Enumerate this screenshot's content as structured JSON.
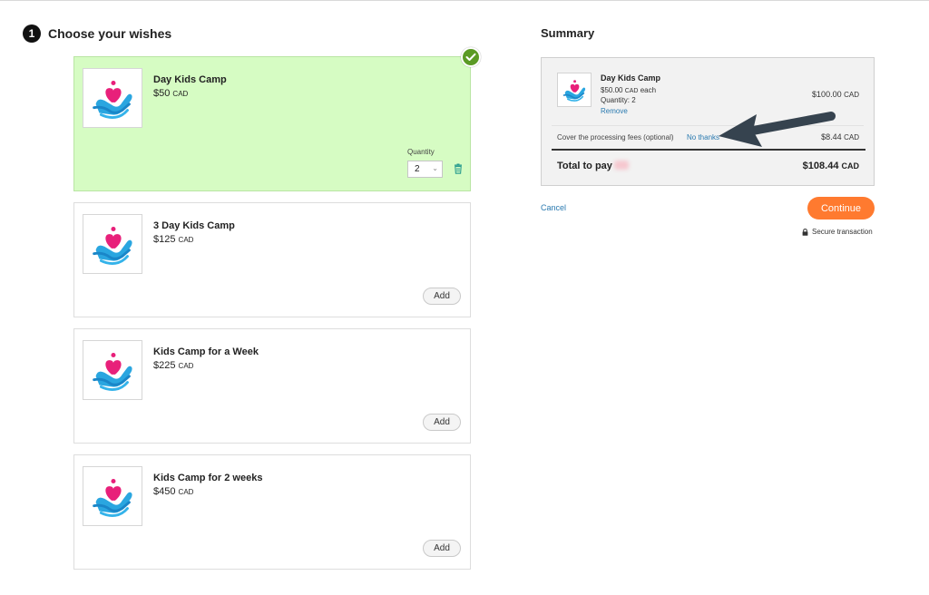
{
  "step": {
    "number": "1",
    "title": "Choose your wishes"
  },
  "items": [
    {
      "name": "Day Kids Camp",
      "price": "$50",
      "currency": "CAD",
      "selected": true,
      "quantity_label": "Quantity",
      "quantity": "2"
    },
    {
      "name": "3 Day Kids Camp",
      "price": "$125",
      "currency": "CAD",
      "add_label": "Add"
    },
    {
      "name": "Kids Camp for a Week",
      "price": "$225",
      "currency": "CAD",
      "add_label": "Add"
    },
    {
      "name": "Kids Camp for 2 weeks",
      "price": "$450",
      "currency": "CAD",
      "add_label": "Add"
    }
  ],
  "icons": {
    "item_image": "hand-holding-heart-icon",
    "selected_badge": "check-icon",
    "delete": "trash-icon",
    "secure": "lock-icon"
  },
  "summary": {
    "title": "Summary",
    "line": {
      "name": "Day Kids Camp",
      "each_price": "$50.00",
      "each_currency": "CAD",
      "each_suffix": "each",
      "quantity": "Quantity: 2",
      "remove_label": "Remove",
      "total": "$100.00",
      "total_currency": "CAD"
    },
    "fee": {
      "label": "Cover the processing fees (optional)",
      "decline_label": "No thanks",
      "amount": "$8.44",
      "currency": "CAD"
    },
    "total_label": "Total to pay",
    "total_amount": "$108.44",
    "total_currency": "CAD"
  },
  "actions": {
    "cancel_label": "Cancel",
    "continue_label": "Continue",
    "secure_label": "Secure transaction"
  },
  "colors": {
    "selected_bg": "#d6fcc3",
    "check_badge": "#5b9a25",
    "continue_btn": "#ff7a2f",
    "link": "#2a7ab0",
    "annotation_arrow": "#36434f"
  }
}
